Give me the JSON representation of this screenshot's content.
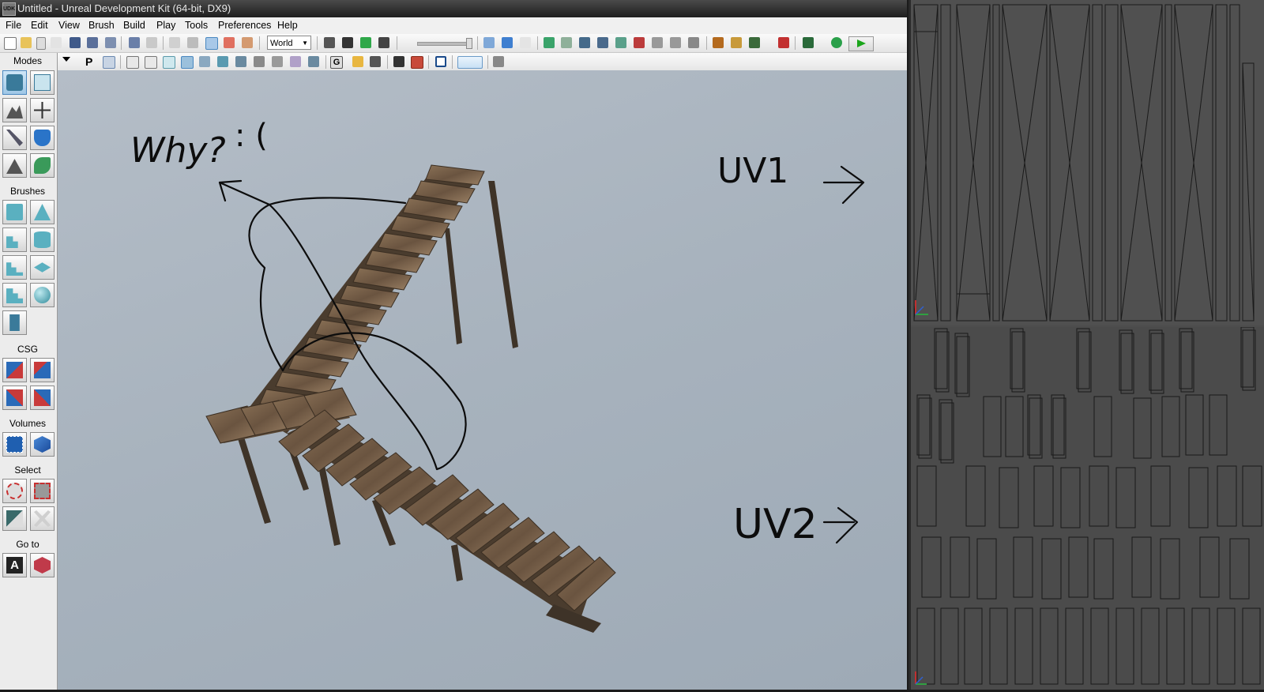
{
  "window": {
    "title": "Untitled - Unreal Development Kit (64-bit, DX9)",
    "app_icon_text": "UDK"
  },
  "menu": [
    "File",
    "Edit",
    "View",
    "Brush",
    "Build",
    "Play",
    "Tools",
    "Preferences",
    "Help"
  ],
  "toolbar": {
    "coord_system": "World",
    "play_icon": "play-icon"
  },
  "side_panel": {
    "modes_label": "Modes",
    "brushes_label": "Brushes",
    "csg_label": "CSG",
    "volumes_label": "Volumes",
    "select_label": "Select",
    "goto_label": "Go to"
  },
  "annotations": {
    "why": "Why?",
    "sad": ": (",
    "uv1": "UV1",
    "uv2": "UV2"
  },
  "colors": {
    "viewport_bg": "#a9b4bf",
    "uv_bg": "#4d4d4d",
    "wood": "#7a6248",
    "title_bg": "#2a2a2a"
  }
}
